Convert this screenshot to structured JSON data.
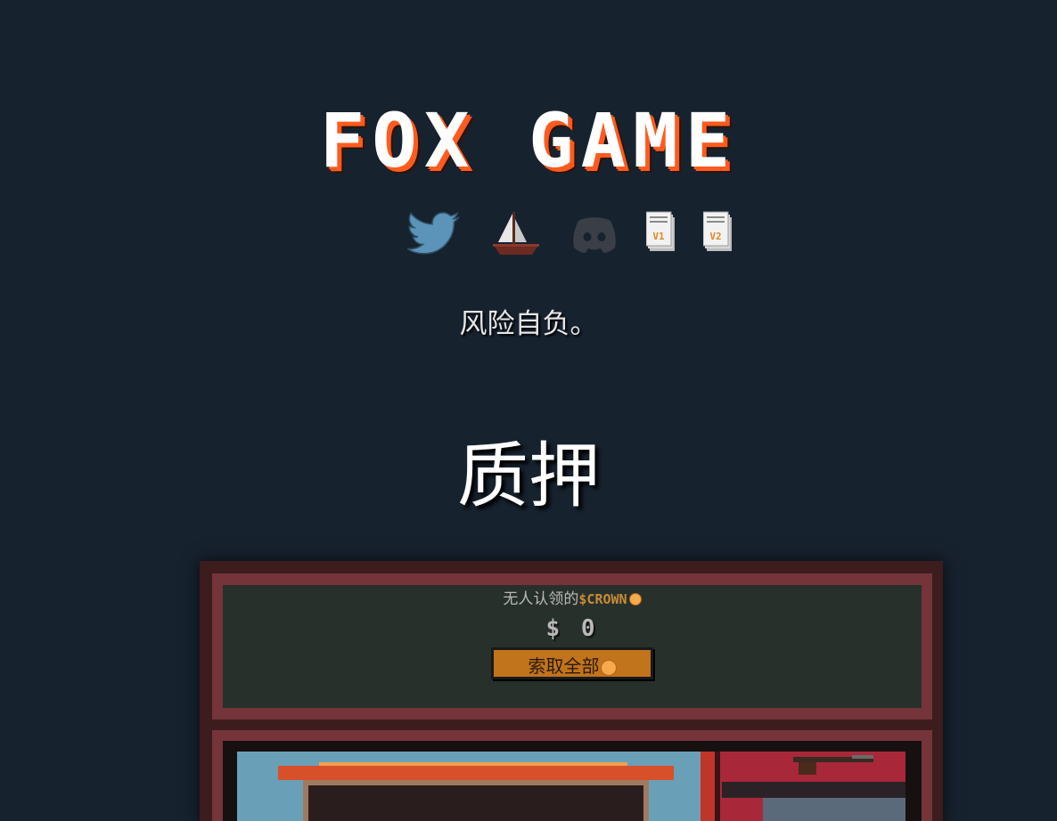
{
  "logo": {
    "text": "FOX GAME"
  },
  "socials": [
    {
      "name": "twitter",
      "icon": "twitter-bird-icon"
    },
    {
      "name": "opensea",
      "icon": "sailboat-icon"
    },
    {
      "name": "discord",
      "icon": "discord-controller-icon"
    },
    {
      "name": "whitepaper-v1",
      "icon": "paper-stack-icon",
      "label": "V1"
    },
    {
      "name": "whitepaper-v2",
      "icon": "paper-stack-icon",
      "label": "V2"
    }
  ],
  "tagline": "风险自负。",
  "section_title": "质押",
  "claim": {
    "label": "无人认领的",
    "token": "$CROWN",
    "amount": "$ 0",
    "button_label": "索取全部"
  },
  "colors": {
    "background": "#17222f",
    "logo_accent": "#ff5a1f",
    "panel_frame": "#74343a",
    "claim_bg": "#27302b",
    "button": "#c1741c"
  }
}
